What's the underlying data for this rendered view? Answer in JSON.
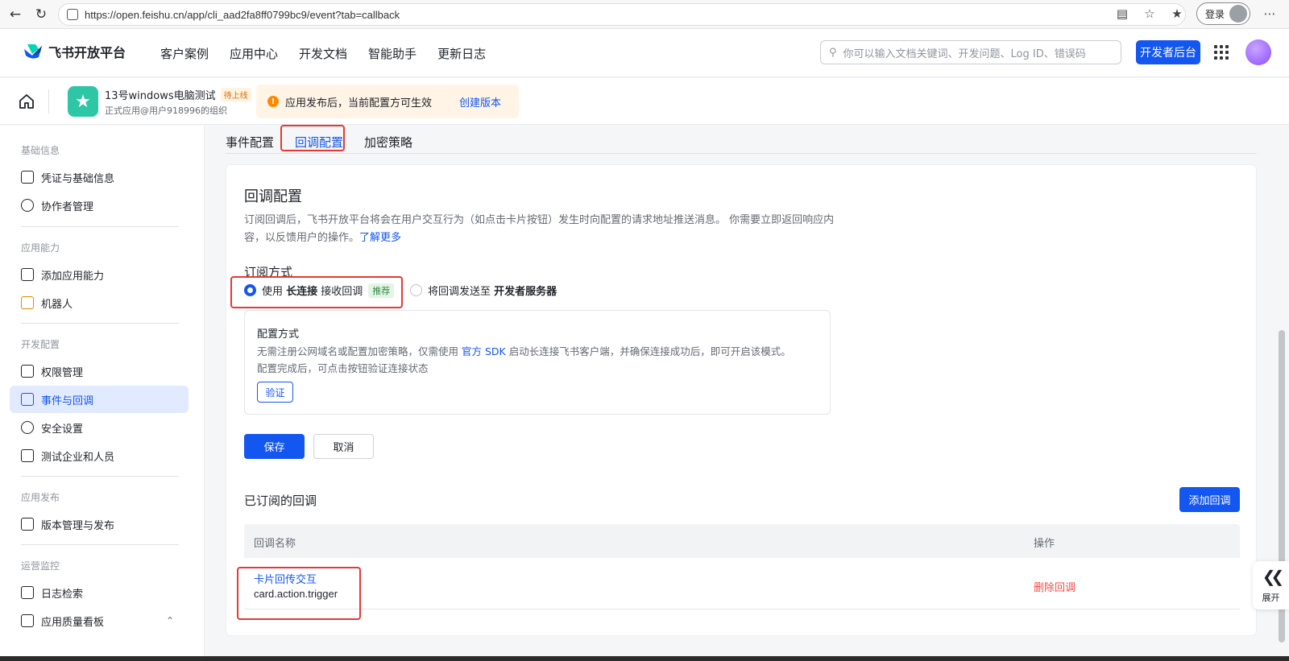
{
  "browser": {
    "url": "https://open.feishu.cn/app/cli_aad2fa8ff0799bc9/event?tab=callback",
    "login_label": "登录"
  },
  "topnav": {
    "brand": "飞书开放平台",
    "menu": [
      "客户案例",
      "应用中心",
      "开发文档",
      "智能助手",
      "更新日志"
    ],
    "search_placeholder": "你可以输入文档关键词、开发问题、Log ID、错误码",
    "dev_console": "开发者后台"
  },
  "appbar": {
    "app_name": "13号windows电脑测试",
    "status_badge": "待上线",
    "org": "正式应用@用户918996的组织",
    "notice": "应用发布后，当前配置方可生效",
    "notice_link": "创建版本"
  },
  "sidebar": {
    "sections": [
      {
        "title": "基础信息",
        "items": [
          "凭证与基础信息",
          "协作者管理"
        ]
      },
      {
        "title": "应用能力",
        "items": [
          "添加应用能力",
          "机器人"
        ]
      },
      {
        "title": "开发配置",
        "items": [
          "权限管理",
          "事件与回调",
          "安全设置",
          "测试企业和人员"
        ]
      },
      {
        "title": "应用发布",
        "items": [
          "版本管理与发布"
        ]
      },
      {
        "title": "运营监控",
        "items": [
          "日志检索",
          "应用质量看板"
        ]
      }
    ],
    "active_item": "事件与回调"
  },
  "tabs": [
    "事件配置",
    "回调配置",
    "加密策略"
  ],
  "active_tab": "回调配置",
  "callback": {
    "title": "回调配置",
    "desc_line1": "订阅回调后，飞书开放平台将会在用户交互行为（如点击卡片按钮）发生时向配置的请求地址推送消息。 你需要立即返回响应内",
    "desc_line2": "容，以反馈用户的操作。",
    "learn_more": "了解更多",
    "sub_method_label": "订阅方式",
    "option1_pre": "使用 ",
    "option1_bold": "长连接",
    "option1_post": " 接收回调",
    "option1_tag": "推荐",
    "option2_pre": "将回调发送至 ",
    "option2_bold": "开发者服务器",
    "config": {
      "title": "配置方式",
      "desc_pre": "无需注册公网域名或配置加密策略，仅需使用 ",
      "desc_link": "官方 SDK",
      "desc_post": " 启动长连接飞书客户端，并确保连接成功后，即可开启该模式。",
      "desc_line2": "配置完成后，可点击按钮验证连接状态",
      "verify": "验证"
    },
    "save": "保存",
    "cancel": "取消"
  },
  "subscribed": {
    "title": "已订阅的回调",
    "add_button": "添加回调",
    "columns": [
      "回调名称",
      "操作"
    ],
    "rows": [
      {
        "name": "卡片回传交互",
        "key": "card.action.trigger",
        "action": "删除回调"
      }
    ]
  },
  "expand_label": "展开"
}
